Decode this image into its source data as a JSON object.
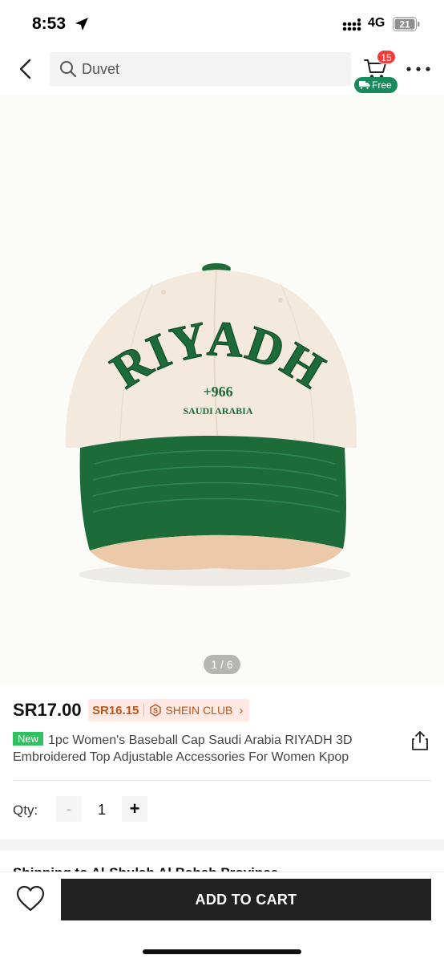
{
  "status_bar": {
    "time": "8:53",
    "network": "4G",
    "battery": "21"
  },
  "header": {
    "search_placeholder": "Duvet",
    "cart_count": "15",
    "free_label": "Free"
  },
  "product": {
    "image_counter": "1 / 6",
    "image_text": {
      "main": "RIYADH",
      "code": "+966",
      "sub": "SAUDI ARABIA"
    },
    "price": "SR17.00",
    "club_price": "SR16.15",
    "club_label": "SHEIN CLUB",
    "new_tag": "New",
    "title": "1pc Women's Baseball Cap Saudi Arabia RIYADH 3D Embroidered Top Adjustable  Accessories For Women Kpop"
  },
  "qty": {
    "label": "Qty:",
    "minus": "-",
    "value": "1",
    "plus": "+"
  },
  "shipping": {
    "text": "Shipping to Al-Shulah Al Bahah Province"
  },
  "bottom": {
    "add_to_cart": "ADD TO CART"
  },
  "colors": {
    "cap_green": "#1d6b39",
    "cap_cream": "#f3e9dc",
    "club_bg": "#ffe9e2",
    "club_text": "#b8561e",
    "free_green": "#188a5c",
    "badge_red": "#f23b3b"
  }
}
